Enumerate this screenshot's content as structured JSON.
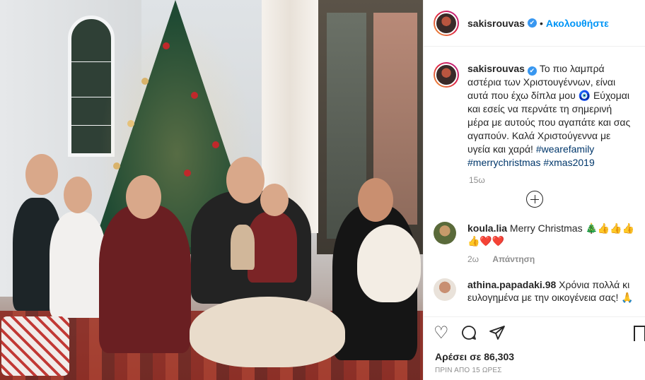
{
  "post": {
    "username": "sakisrouvas",
    "follow_label": "Ακολουθήστε",
    "separator": "•",
    "verified_mark": "✔"
  },
  "caption": {
    "username": "sakisrouvas",
    "text": "Το πιο λαμπρά αστέρια των Χριστουγέννων, είναι αυτά που έχω δίπλα μου 🧿 Εύχομαι και εσείς να περνάτε τη σημερινή μέρα με αυτούς που αγαπάτε και σας αγαπούν. Καλά Χριστούγεννα με υγεία και χαρά!",
    "tags": [
      "#wearefamily",
      "#merrychristmas",
      "#xmas2019"
    ],
    "age": "15ω"
  },
  "comments": [
    {
      "username": "koula.lia",
      "text": "Merry Christmas 🎄👍👍👍👍❤️❤️",
      "age": "2ω",
      "reply_label": "Απάντηση"
    },
    {
      "username": "athina.papadaki.98",
      "text": "Χρόνια πολλά κι ευλογημένα με την οικογένεια σας! 🙏",
      "age": "",
      "reply_label": ""
    }
  ],
  "actions": {
    "like_icon": "heart-icon",
    "comment_icon": "comment-icon",
    "share_icon": "share-icon",
    "save_icon": "bookmark-icon"
  },
  "likes_text": "Αρέσει σε 86,303",
  "timestamp": "ΠΡΙΝ ΑΠΟ 15 ΩΡΕΣ",
  "colors": {
    "accent": "#0095f6",
    "hashtag": "#00376b",
    "verified": "#3897f0",
    "muted": "#8e8e8e"
  }
}
